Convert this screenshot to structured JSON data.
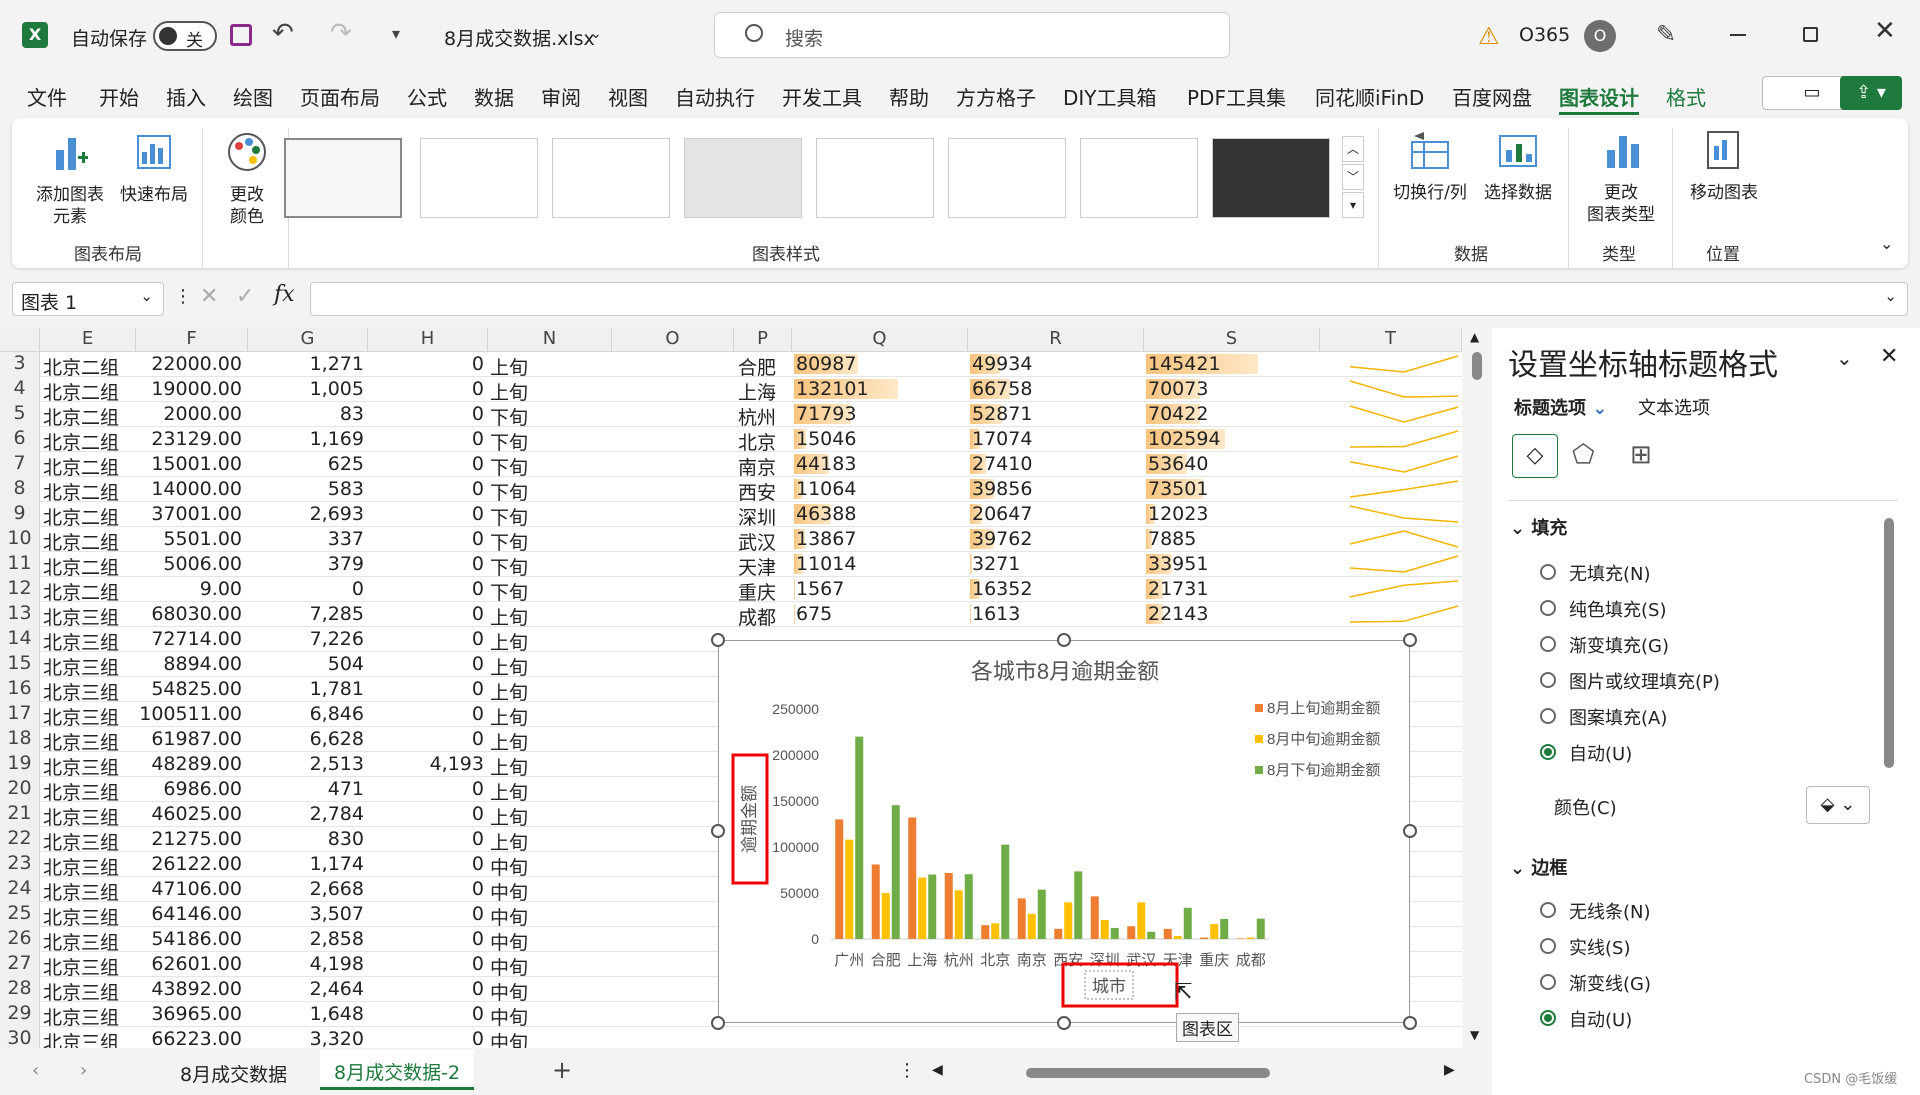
{
  "titlebar": {
    "autosave_label": "自动保存",
    "autosave_state": "关",
    "filename": "8月成交数据.xlsx",
    "search_placeholder": "搜索",
    "account": "O365",
    "avatar_letter": "O"
  },
  "tabs": [
    "文件",
    "开始",
    "插入",
    "绘图",
    "页面布局",
    "公式",
    "数据",
    "审阅",
    "视图",
    "自动执行",
    "开发工具",
    "帮助",
    "方方格子",
    "DIY工具箱",
    "PDF工具集",
    "同花顺iFinD",
    "百度网盘",
    "图表设计",
    "格式"
  ],
  "ribbon": {
    "add_element": "添加图表\n元素",
    "quick_layout": "快速布局",
    "change_color": "更改\n颜色",
    "group_layout": "图表布局",
    "group_styles": "图表样式",
    "switch_row_col": "切换行/列",
    "select_data": "选择数据",
    "group_data": "数据",
    "change_type": "更改\n图表类型",
    "group_type": "类型",
    "move_chart": "移动图表",
    "group_location": "位置"
  },
  "namebox": "图表 1",
  "formula_fx": "fx",
  "columns": [
    "E",
    "F",
    "G",
    "H",
    "N",
    "O",
    "P",
    "Q",
    "R",
    "S",
    "T"
  ],
  "rows": [
    {
      "n": "3",
      "e": "北京二组",
      "f": "22000.00",
      "g": "1,271",
      "h": "0",
      "nn": "上旬",
      "p": "合肥",
      "q": "80987",
      "r": "49934",
      "s": "145421"
    },
    {
      "n": "4",
      "e": "北京二组",
      "f": "19000.00",
      "g": "1,005",
      "h": "0",
      "nn": "上旬",
      "p": "上海",
      "q": "132101",
      "r": "66758",
      "s": "70073"
    },
    {
      "n": "5",
      "e": "北京二组",
      "f": "2000.00",
      "g": "83",
      "h": "0",
      "nn": "下旬",
      "p": "杭州",
      "q": "71793",
      "r": "52871",
      "s": "70422"
    },
    {
      "n": "6",
      "e": "北京二组",
      "f": "23129.00",
      "g": "1,169",
      "h": "0",
      "nn": "下旬",
      "p": "北京",
      "q": "15046",
      "r": "17074",
      "s": "102594"
    },
    {
      "n": "7",
      "e": "北京二组",
      "f": "15001.00",
      "g": "625",
      "h": "0",
      "nn": "下旬",
      "p": "南京",
      "q": "44183",
      "r": "27410",
      "s": "53640"
    },
    {
      "n": "8",
      "e": "北京二组",
      "f": "14000.00",
      "g": "583",
      "h": "0",
      "nn": "下旬",
      "p": "西安",
      "q": "11064",
      "r": "39856",
      "s": "73501"
    },
    {
      "n": "9",
      "e": "北京二组",
      "f": "37001.00",
      "g": "2,693",
      "h": "0",
      "nn": "下旬",
      "p": "深圳",
      "q": "46388",
      "r": "20647",
      "s": "12023"
    },
    {
      "n": "10",
      "e": "北京二组",
      "f": "5501.00",
      "g": "337",
      "h": "0",
      "nn": "下旬",
      "p": "武汉",
      "q": "13867",
      "r": "39762",
      "s": "7885"
    },
    {
      "n": "11",
      "e": "北京二组",
      "f": "5006.00",
      "g": "379",
      "h": "0",
      "nn": "下旬",
      "p": "天津",
      "q": "11014",
      "r": "3271",
      "s": "33951"
    },
    {
      "n": "12",
      "e": "北京二组",
      "f": "9.00",
      "g": "0",
      "h": "0",
      "nn": "下旬",
      "p": "重庆",
      "q": "1567",
      "r": "16352",
      "s": "21731"
    },
    {
      "n": "13",
      "e": "北京三组",
      "f": "68030.00",
      "g": "7,285",
      "h": "0",
      "nn": "上旬",
      "p": "成都",
      "q": "675",
      "r": "1613",
      "s": "22143"
    },
    {
      "n": "14",
      "e": "北京三组",
      "f": "72714.00",
      "g": "7,226",
      "h": "0",
      "nn": "上旬"
    },
    {
      "n": "15",
      "e": "北京三组",
      "f": "8894.00",
      "g": "504",
      "h": "0",
      "nn": "上旬"
    },
    {
      "n": "16",
      "e": "北京三组",
      "f": "54825.00",
      "g": "1,781",
      "h": "0",
      "nn": "上旬"
    },
    {
      "n": "17",
      "e": "北京三组",
      "f": "100511.00",
      "g": "6,846",
      "h": "0",
      "nn": "上旬"
    },
    {
      "n": "18",
      "e": "北京三组",
      "f": "61987.00",
      "g": "6,628",
      "h": "0",
      "nn": "上旬"
    },
    {
      "n": "19",
      "e": "北京三组",
      "f": "48289.00",
      "g": "2,513",
      "h": "4,193",
      "nn": "上旬"
    },
    {
      "n": "20",
      "e": "北京三组",
      "f": "6986.00",
      "g": "471",
      "h": "0",
      "nn": "上旬"
    },
    {
      "n": "21",
      "e": "北京三组",
      "f": "46025.00",
      "g": "2,784",
      "h": "0",
      "nn": "上旬"
    },
    {
      "n": "22",
      "e": "北京三组",
      "f": "21275.00",
      "g": "830",
      "h": "0",
      "nn": "上旬"
    },
    {
      "n": "23",
      "e": "北京三组",
      "f": "26122.00",
      "g": "1,174",
      "h": "0",
      "nn": "中旬"
    },
    {
      "n": "24",
      "e": "北京三组",
      "f": "47106.00",
      "g": "2,668",
      "h": "0",
      "nn": "中旬"
    },
    {
      "n": "25",
      "e": "北京三组",
      "f": "64146.00",
      "g": "3,507",
      "h": "0",
      "nn": "中旬"
    },
    {
      "n": "26",
      "e": "北京三组",
      "f": "54186.00",
      "g": "2,858",
      "h": "0",
      "nn": "中旬"
    },
    {
      "n": "27",
      "e": "北京三组",
      "f": "62601.00",
      "g": "4,198",
      "h": "0",
      "nn": "中旬"
    },
    {
      "n": "28",
      "e": "北京三组",
      "f": "43892.00",
      "g": "2,464",
      "h": "0",
      "nn": "中旬"
    },
    {
      "n": "29",
      "e": "北京三组",
      "f": "36965.00",
      "g": "1,648",
      "h": "0",
      "nn": "中旬"
    },
    {
      "n": "30",
      "e": "北京三组",
      "f": "66223.00",
      "g": "3,320",
      "h": "0",
      "nn": "中旬"
    }
  ],
  "chart_data": {
    "type": "bar",
    "title": "各城市8月逾期金额",
    "xlabel": "城市",
    "ylabel": "逾期金额",
    "ylim": [
      0,
      250000
    ],
    "yticks": [
      "250000",
      "200000",
      "150000",
      "100000",
      "50000",
      "0"
    ],
    "categories": [
      "广州",
      "合肥",
      "上海",
      "杭州",
      "北京",
      "南京",
      "西安",
      "深圳",
      "武汉",
      "天津",
      "重庆",
      "成都"
    ],
    "series": [
      {
        "name": "8月上旬逾期金额",
        "color": "#ed7d31",
        "values": [
          130000,
          80987,
          132101,
          71793,
          15046,
          44183,
          11064,
          46388,
          13867,
          11014,
          1567,
          675
        ]
      },
      {
        "name": "8月中旬逾期金额",
        "color": "#ffc000",
        "values": [
          108000,
          49934,
          66758,
          52871,
          17074,
          27410,
          39856,
          20647,
          39762,
          3271,
          16352,
          1613
        ]
      },
      {
        "name": "8月下旬逾期金额",
        "color": "#70ad47",
        "values": [
          220000,
          145421,
          70073,
          70422,
          102594,
          53640,
          73501,
          12023,
          7885,
          33951,
          21731,
          22143
        ]
      }
    ],
    "legend": "top-right",
    "tooltip": "图表区"
  },
  "pane": {
    "title": "设置坐标轴标题格式",
    "tab_title_options": "标题选项",
    "tab_text_options": "文本选项",
    "fill_header": "填充",
    "fill_options": [
      "无填充(N)",
      "纯色填充(S)",
      "渐变填充(G)",
      "图片或纹理填充(P)",
      "图案填充(A)",
      "自动(U)"
    ],
    "color_label": "颜色(C)",
    "border_header": "边框",
    "border_options": [
      "无线条(N)",
      "实线(S)",
      "渐变线(G)",
      "自动(U)"
    ]
  },
  "sheets": [
    "8月成交数据",
    "8月成交数据-2"
  ],
  "watermark": "CSDN @毛饭缓"
}
